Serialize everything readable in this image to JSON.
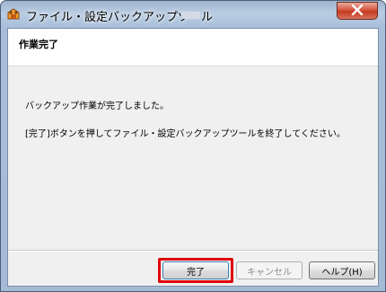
{
  "window": {
    "title": "ファイル・設定バックアップツール",
    "icon": "app-icon",
    "close_glyph": "✕"
  },
  "header": {
    "title": "作業完了"
  },
  "content": {
    "message_1": "バックアップ作業が完了しました。",
    "message_2": "[完了]ボタンを押してファイル・設定バックアップツールを終了してください。"
  },
  "buttons": {
    "finish_label": "完了",
    "cancel_label": "キャンセル",
    "help_label": "ヘルプ(H)",
    "cancel_enabled": false
  },
  "colors": {
    "highlight": "#e0000b",
    "close_button": "#c43b22"
  }
}
